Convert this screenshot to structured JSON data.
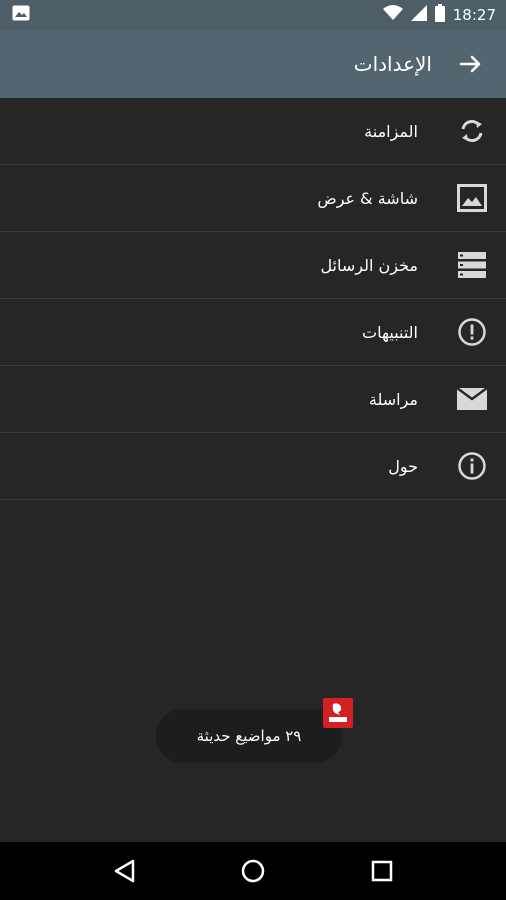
{
  "status_bar": {
    "time": "18:27",
    "icons": [
      "image-notification-icon",
      "wifi-icon",
      "signal-icon",
      "battery-icon"
    ]
  },
  "toolbar": {
    "title": "الإعدادات",
    "back_icon": "arrow-back-icon"
  },
  "settings": {
    "items": [
      {
        "label": "المزامنة",
        "icon": "sync-icon"
      },
      {
        "label": "شاشة & عرض",
        "icon": "image-icon"
      },
      {
        "label": "مخزن الرسائل",
        "icon": "storage-icon"
      },
      {
        "label": "التنبيهات",
        "icon": "alert-icon"
      },
      {
        "label": "مراسلة",
        "icon": "mail-icon"
      },
      {
        "label": "حول",
        "icon": "info-icon"
      }
    ]
  },
  "toast": {
    "text": "٢٩ مواضيع حديثة",
    "badge_icon": "app-logo-icon"
  },
  "nav": {
    "back_icon": "nav-back-icon",
    "home_icon": "nav-home-icon",
    "recents_icon": "nav-recents-icon"
  },
  "colors": {
    "toolbar": "#536670",
    "status_bar": "#4d5e66",
    "background": "#262626",
    "badge": "#d32024"
  }
}
